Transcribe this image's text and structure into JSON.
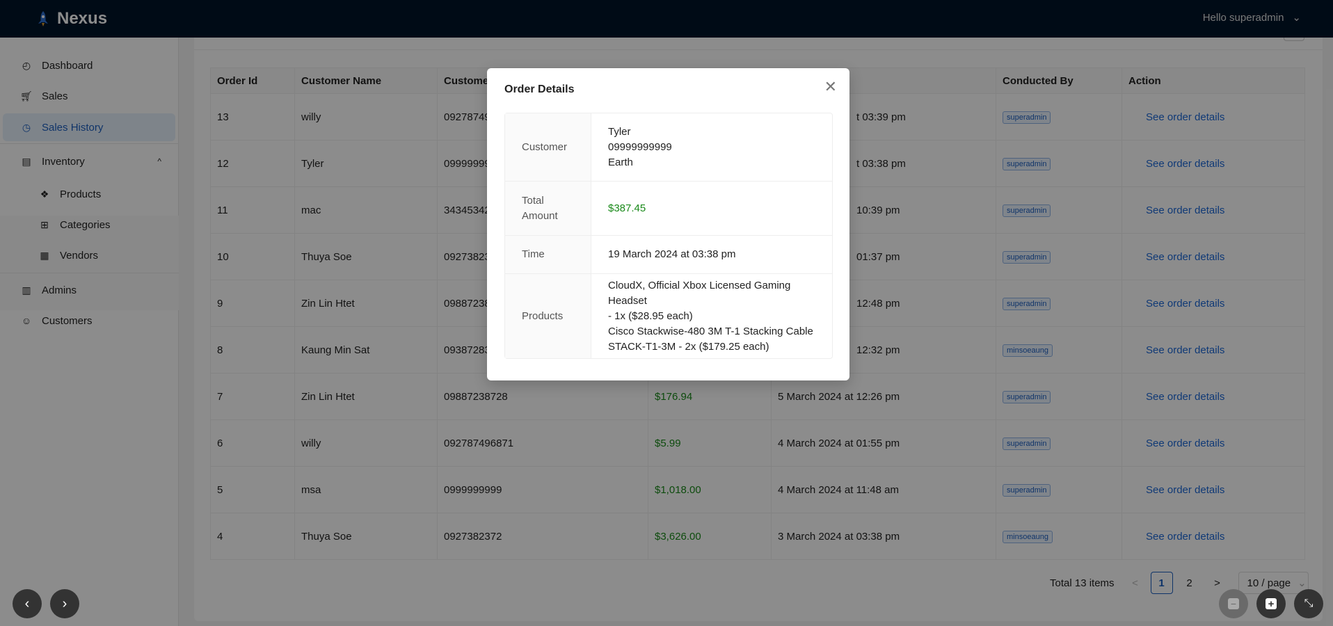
{
  "app": {
    "name": "Nexus",
    "greeting": "Hello superadmin"
  },
  "sidebar": {
    "items": [
      {
        "label": "Dashboard",
        "icon": "dashboard-icon"
      },
      {
        "label": "Sales",
        "icon": "cart-icon"
      },
      {
        "label": "Sales History",
        "icon": "history-icon",
        "active": true
      },
      {
        "label": "Inventory",
        "icon": "inventory-icon",
        "expanded": true
      },
      {
        "label": "Products",
        "icon": "dropbox-icon"
      },
      {
        "label": "Categories",
        "icon": "grid-icon"
      },
      {
        "label": "Vendors",
        "icon": "shop-icon"
      },
      {
        "label": "Admins",
        "icon": "admin-icon"
      },
      {
        "label": "Customers",
        "icon": "user-icon"
      }
    ]
  },
  "table": {
    "headers": [
      "Order Id",
      "Customer Name",
      "Customer",
      "",
      "",
      "Conducted By",
      "Action"
    ],
    "rows": [
      {
        "id": "13",
        "name": "willy",
        "phone": "09278749",
        "amount": "",
        "time": "t 03:39 pm",
        "by": "superadmin",
        "action": "See order details"
      },
      {
        "id": "12",
        "name": "Tyler",
        "phone": "09999999",
        "amount": "",
        "time": "t 03:38 pm",
        "by": "superadmin",
        "action": "See order details"
      },
      {
        "id": "11",
        "name": "mac",
        "phone": "34345342",
        "amount": "",
        "time": "10:39 pm",
        "by": "superadmin",
        "action": "See order details"
      },
      {
        "id": "10",
        "name": "Thuya Soe",
        "phone": "09273823",
        "amount": "",
        "time": "01:37 pm",
        "by": "superadmin",
        "action": "See order details"
      },
      {
        "id": "9",
        "name": "Zin Lin Htet",
        "phone": "09887238",
        "amount": "",
        "time": "12:48 pm",
        "by": "superadmin",
        "action": "See order details"
      },
      {
        "id": "8",
        "name": "Kaung Min Sat",
        "phone": "09387283",
        "amount": "",
        "time": "12:32 pm",
        "by": "minsoeaung",
        "action": "See order details"
      },
      {
        "id": "7",
        "name": "Zin Lin Htet",
        "phone": "09887238728",
        "amount": "$176.94",
        "time": "5 March 2024 at 12:26 pm",
        "by": "superadmin",
        "action": "See order details"
      },
      {
        "id": "6",
        "name": "willy",
        "phone": "092787496871",
        "amount": "$5.99",
        "time": "4 March 2024 at 01:55 pm",
        "by": "superadmin",
        "action": "See order details"
      },
      {
        "id": "5",
        "name": "msa",
        "phone": "0999999999",
        "amount": "$1,018.00",
        "time": "4 March 2024 at 11:48 am",
        "by": "superadmin",
        "action": "See order details"
      },
      {
        "id": "4",
        "name": "Thuya Soe",
        "phone": "0927382372",
        "amount": "$3,626.00",
        "time": "3 March 2024 at 03:38 pm",
        "by": "minsoeaung",
        "action": "See order details"
      }
    ]
  },
  "pagination": {
    "total": "Total 13 items",
    "prev": "<",
    "pages": [
      "1",
      "2"
    ],
    "current": "1",
    "next": ">",
    "page_size": "10 / page"
  },
  "modal": {
    "title": "Order Details",
    "rows": [
      {
        "label": "Customer",
        "lines": [
          "Tyler",
          "09999999999",
          "Earth"
        ]
      },
      {
        "label": "Total Amount",
        "lines": [
          "$387.45"
        ]
      },
      {
        "label": "Time",
        "lines": [
          "19 March 2024 at 03:38 pm"
        ]
      },
      {
        "label": "Products",
        "lines": [
          "CloudX, Official Xbox Licensed Gaming Headset",
          "- 1x ($28.95 each)",
          "Cisco Stackwise-480 3M T-1 Stacking Cable",
          "STACK-T1-3M - 2x ($179.25 each)"
        ]
      }
    ]
  },
  "colors": {
    "header": "#001529",
    "accent": "#1d5fc0",
    "amount": "#1a8a1a"
  }
}
